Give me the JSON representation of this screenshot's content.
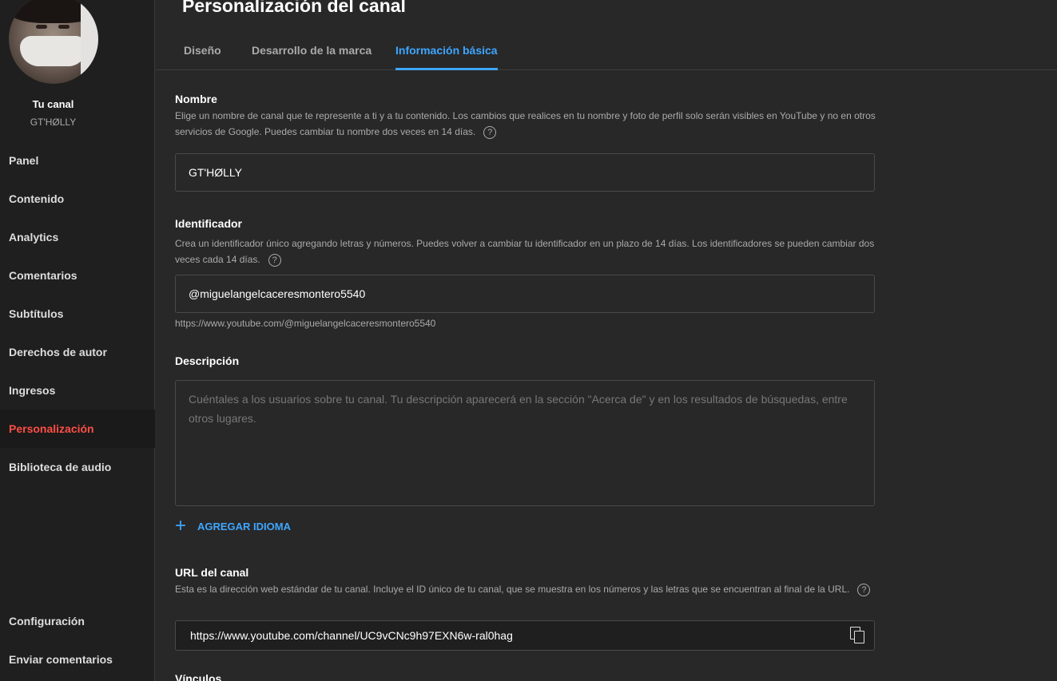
{
  "sidebar": {
    "channel_label": "Tu canal",
    "channel_handle": "GT'HØLLY",
    "items": [
      {
        "label": "Panel"
      },
      {
        "label": "Contenido"
      },
      {
        "label": "Analytics"
      },
      {
        "label": "Comentarios"
      },
      {
        "label": "Subtítulos"
      },
      {
        "label": "Derechos de autor"
      },
      {
        "label": "Ingresos"
      },
      {
        "label": "Personalización"
      },
      {
        "label": "Biblioteca de audio"
      }
    ],
    "bottom_items": [
      {
        "label": "Configuración"
      },
      {
        "label": "Enviar comentarios"
      }
    ],
    "active_item": "Personalización"
  },
  "header": {
    "title": "Personalización del canal"
  },
  "tabs": [
    {
      "label": "Diseño"
    },
    {
      "label": "Desarrollo de la marca"
    },
    {
      "label": "Información básica"
    }
  ],
  "active_tab": "Información básica",
  "name_section": {
    "title": "Nombre",
    "help": "Elige un nombre de canal que te represente a ti y a tu contenido. Los cambios que realices en tu nombre y foto de perfil solo serán visibles en YouTube y no en otros servicios de Google. Puedes cambiar tu nombre dos veces en 14 días.",
    "value": "GT'HØLLY"
  },
  "handle_section": {
    "title": "Identificador",
    "help": "Crea un identificador único agregando letras y números. Puedes volver a cambiar tu identificador en un plazo de 14 días. Los identificadores se pueden cambiar dos veces cada 14 días.",
    "value": "@miguelangelcaceresmontero5540",
    "url": "https://www.youtube.com/@miguelangelcaceresmontero5540"
  },
  "description_section": {
    "title": "Descripción",
    "placeholder": "Cuéntales a los usuarios sobre tu canal. Tu descripción aparecerá en la sección \"Acerca de\" y en los resultados de búsquedas, entre otros lugares.",
    "add_language_label": "AGREGAR IDIOMA"
  },
  "url_section": {
    "title": "URL del canal",
    "help": "Esta es la dirección web estándar de tu canal. Incluye el ID único de tu canal, que se muestra en los números y las letras que se encuentran al final de la URL.",
    "value": "https://www.youtube.com/channel/UC9vCNc9h97EXN6w-ral0hag"
  },
  "links_section": {
    "title": "Vínculos"
  },
  "help_glyph": "?",
  "add_glyph": "+",
  "colors": {
    "accent": "#3ea6ff",
    "active_nav": "#ff4e45",
    "background": "#282828",
    "sidebar": "#1f1f1f"
  }
}
